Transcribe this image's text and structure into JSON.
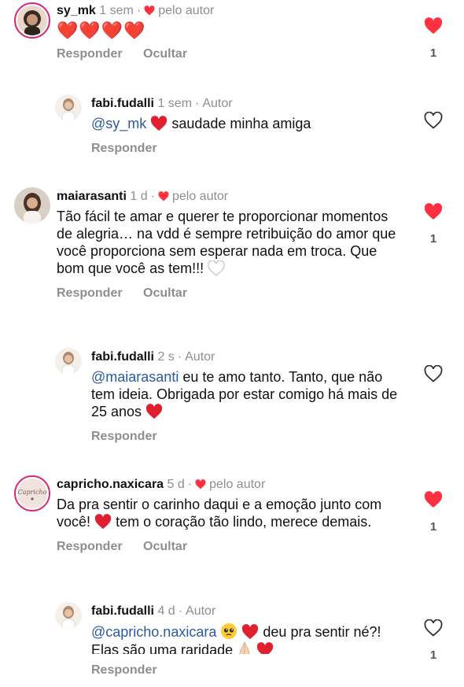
{
  "comments": [
    {
      "user": "sy_mk",
      "time": "1 sem",
      "liked_by_author": "pelo autor",
      "text": "❤️❤️❤️❤️",
      "reply_label": "Responder",
      "hide_label": "Ocultar",
      "likes": "1",
      "reply": {
        "user": "fabi.fudalli",
        "time": "1 sem",
        "author_tag": "Autor",
        "mention": "@sy_mk",
        "text": "saudade minha amiga",
        "reply_label": "Responder"
      }
    },
    {
      "user": "maiarasanti",
      "time": "1 d",
      "liked_by_author": "pelo autor",
      "text": "Tão fácil te amar e querer te proporcionar momentos de alegria… na vdd é sempre retribuição do amor que você proporciona sem esperar nada em troca. Que bom que você as tem!!!",
      "reply_label": "Responder",
      "hide_label": "Ocultar",
      "likes": "1",
      "reply": {
        "user": "fabi.fudalli",
        "time": "2 s",
        "author_tag": "Autor",
        "mention": "@maiarasanti",
        "text": "eu te amo tanto. Tanto, que não tem ideia. Obrigada por estar comigo há mais de 25 anos",
        "reply_label": "Responder"
      }
    },
    {
      "user": "capricho.naxicara",
      "time": "5 d",
      "liked_by_author": "pelo autor",
      "text_a": "Da pra sentir o carinho daqui e a emoção junto com você!",
      "text_b": "tem o coração tão lindo, merece demais.",
      "reply_label": "Responder",
      "hide_label": "Ocultar",
      "likes": "1",
      "avatar_text": "Capricho",
      "reply": {
        "user": "fabi.fudalli",
        "time": "4 d",
        "author_tag": "Autor",
        "mention": "@capricho.naxicara",
        "text_a": "deu pra sentir né?! Elas são uma raridade",
        "reply_label": "Responder",
        "likes": "1"
      }
    }
  ],
  "colors": {
    "heart": "#ff3040",
    "mention": "#2c5a9e",
    "muted": "#8e8e8e"
  }
}
